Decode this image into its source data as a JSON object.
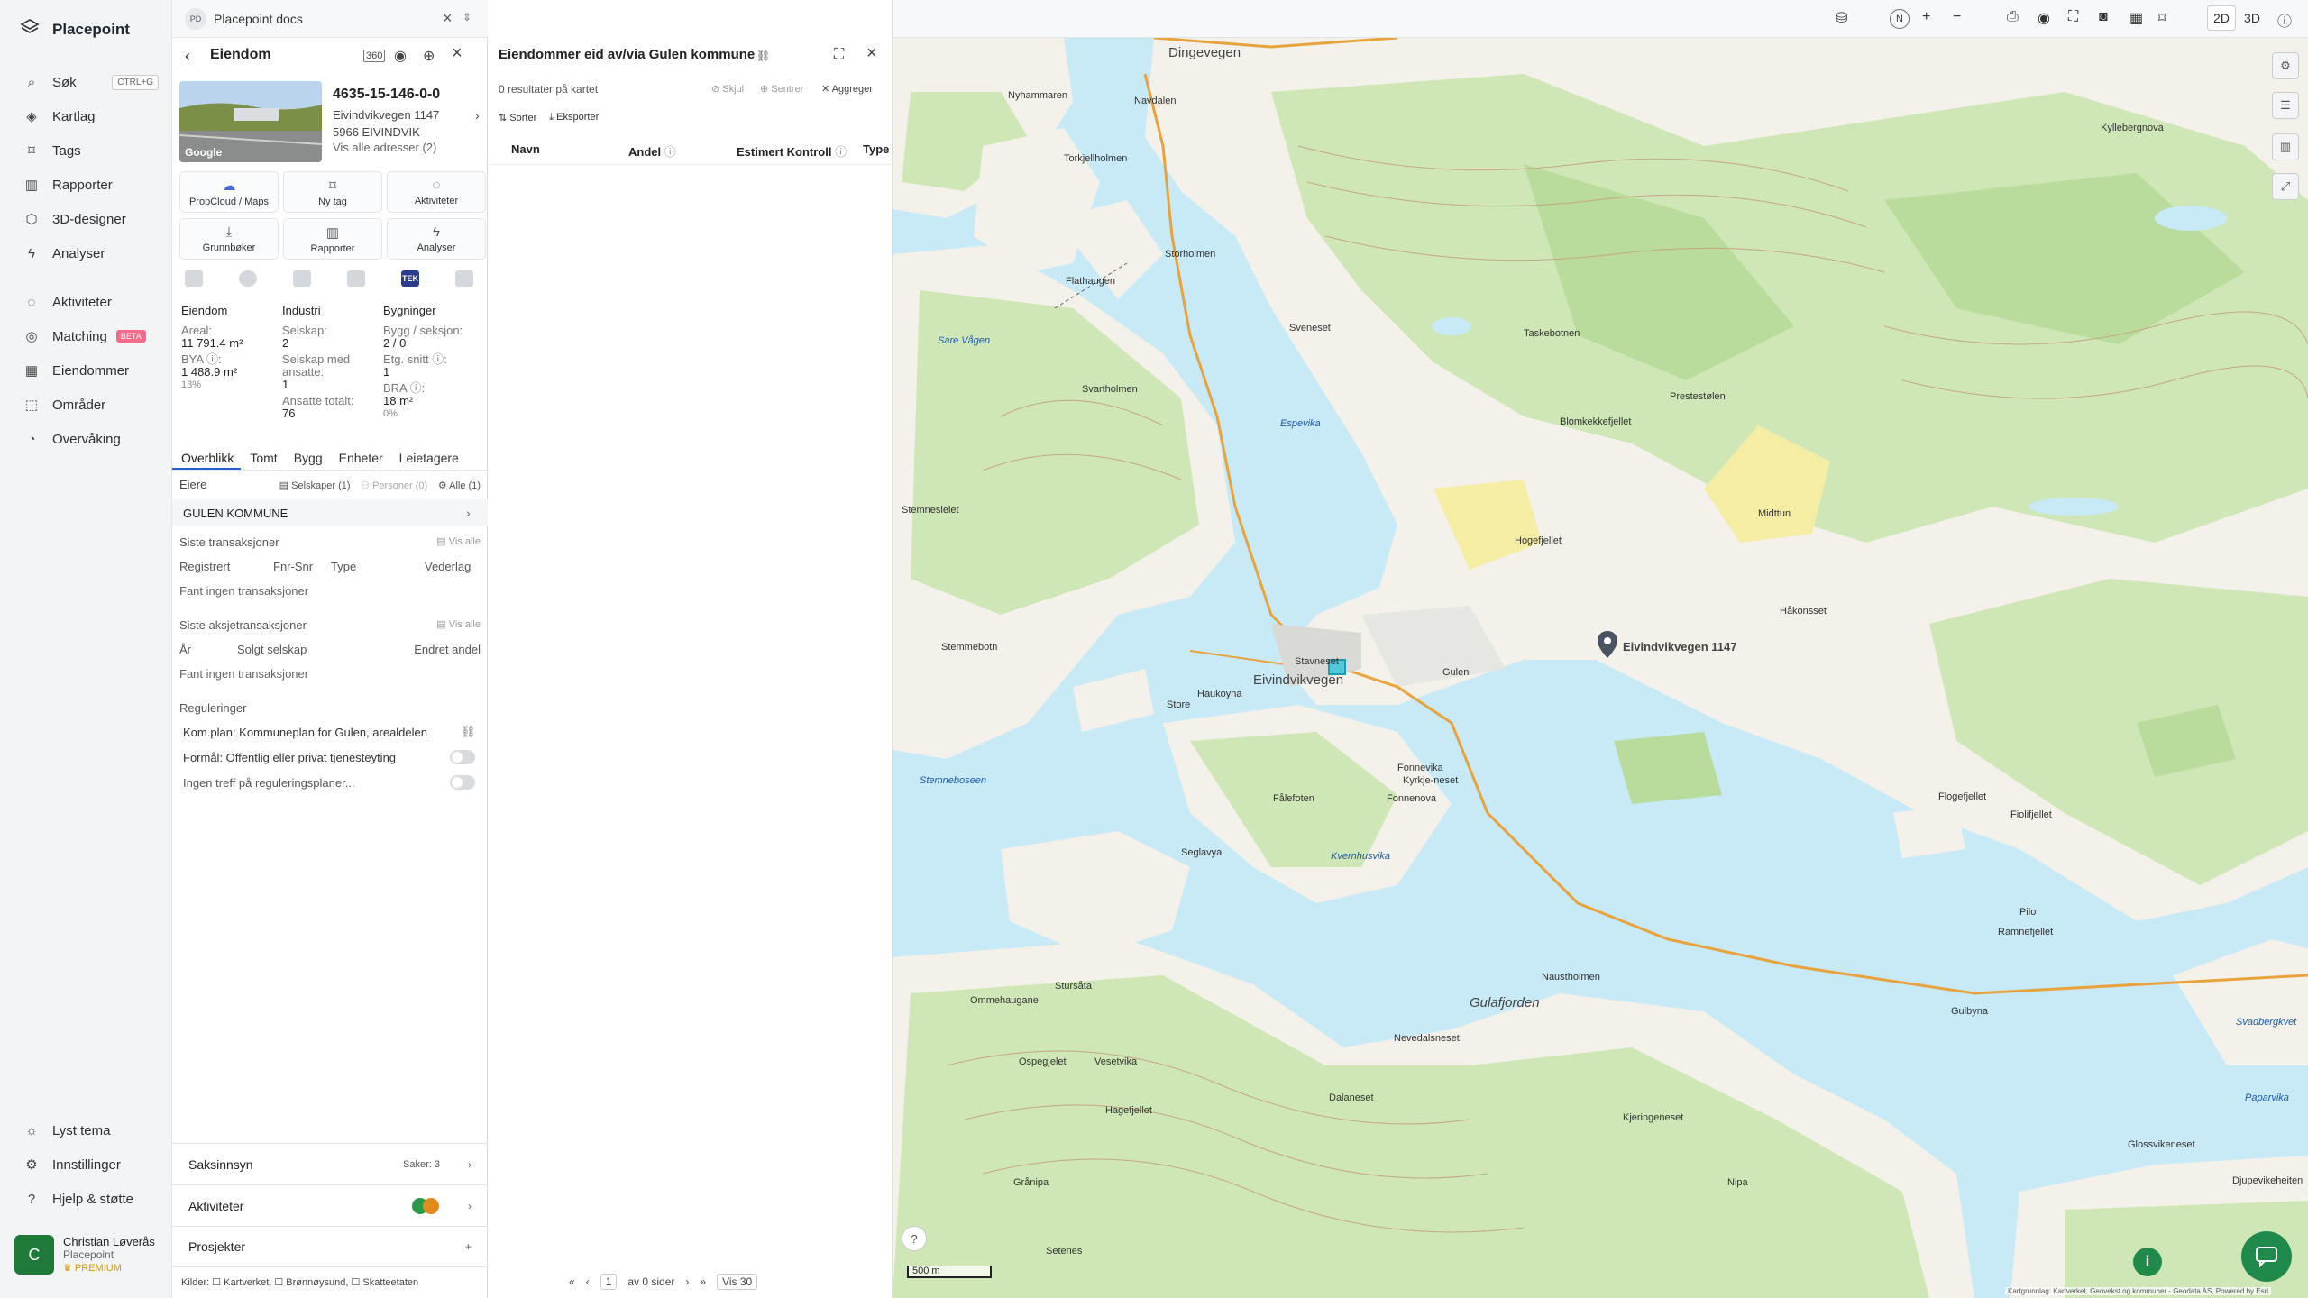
{
  "brand": {
    "name": "Placepoint"
  },
  "nav": {
    "items": [
      {
        "label": "Søk",
        "kbd": "CTRL+G"
      },
      {
        "label": "Kartlag"
      },
      {
        "label": "Tags"
      },
      {
        "label": "Rapporter"
      },
      {
        "label": "3D-designer"
      },
      {
        "label": "Analyser"
      },
      {
        "label": "Aktiviteter"
      },
      {
        "label": "Matching",
        "badge": "BETA"
      },
      {
        "label": "Eiendommer"
      },
      {
        "label": "Områder"
      },
      {
        "label": "Overvåking"
      }
    ],
    "bottom": [
      {
        "label": "Lyst tema"
      },
      {
        "label": "Innstillinger"
      },
      {
        "label": "Hjelp & støtte"
      }
    ]
  },
  "user": {
    "initial": "C",
    "name": "Christian Løverås",
    "org": "Placepoint",
    "tier": "PREMIUM"
  },
  "doc_tab": {
    "badge": "PD",
    "title": "Placepoint docs"
  },
  "panel1": {
    "title": "Eiendom",
    "property": {
      "id": "4635-15-146-0-0",
      "address_line1": "Eivindvikvegen 1147",
      "address_line2": "5966 EIVINDVIK",
      "all_addresses": "Vis alle adresser (2)",
      "thumb_label": "Google"
    },
    "actions": [
      {
        "label": "PropCloud / Maps"
      },
      {
        "label": "Ny tag"
      },
      {
        "label": "Aktiviteter"
      },
      {
        "label": "Grunnbøker"
      },
      {
        "label": "Rapporter"
      },
      {
        "label": "Analyser"
      }
    ],
    "tek_label": "TEK",
    "stats": {
      "col1": {
        "heading": "Eiendom",
        "areal_label": "Areal:",
        "areal_value": "11 791.4 m²",
        "bya_label": "BYA ⓘ:",
        "bya_value": "1 488.9 m²",
        "bya_pct": "13%"
      },
      "col2": {
        "heading": "Industri",
        "selskap_label": "Selskap:",
        "selskap_value": "2",
        "ansatte_label": "Selskap med ansatte:",
        "ansatte_value": "1",
        "totalt_label": "Ansatte totalt:",
        "totalt_value": "76"
      },
      "col3": {
        "heading": "Bygninger",
        "bygg_label": "Bygg / seksjon:",
        "bygg_value": "2 / 0",
        "etg_label": "Etg. snitt ⓘ:",
        "etg_value": "1",
        "bra_label": "BRA ⓘ:",
        "bra_value": "18 m²",
        "bra_pct": "0%"
      }
    },
    "subtabs": [
      "Overblikk",
      "Tomt",
      "Bygg",
      "Enheter",
      "Leietagere"
    ],
    "owners": {
      "label": "Eiere",
      "chip_companies": "Selskaper (1)",
      "chip_persons": "Personer (0)",
      "chip_all": "Alle (1)",
      "owner": "GULEN KOMMUNE"
    },
    "transactions": {
      "heading": "Siste transaksjoner",
      "show_all": "Vis alle",
      "cols": [
        "Registrert",
        "Fnr-Snr",
        "Type",
        "Vederlag"
      ],
      "empty": "Fant ingen transaksjoner"
    },
    "share_tx": {
      "heading": "Siste aksjetransaksjoner",
      "show_all": "Vis alle",
      "cols": [
        "År",
        "Solgt selskap",
        "Endret andel"
      ],
      "empty": "Fant ingen transaksjoner"
    },
    "regulations": {
      "heading": "Reguleringer",
      "plan": "Kom.plan: Kommuneplan for Gulen, arealdelen",
      "purpose": "Formål: Offentlig eller privat tjenesteyting",
      "none": "Ingen treff på reguleringsplaner..."
    },
    "accordions": [
      {
        "label": "Saksinnsyn",
        "right": "Saker: 3"
      },
      {
        "label": "Aktiviteter",
        "right": ""
      },
      {
        "label": "Prosjekter",
        "right": "+"
      }
    ],
    "sources": "Kilder: ☐ Kartverket, ☐ Brønnøysund, ☐ Skatteetaten"
  },
  "panel2": {
    "title": "Eiendommer eid av/via Gulen kommune",
    "results": "0 resultater på kartet",
    "hide": "Skjul",
    "center": "Sentrer",
    "aggregate": "Aggreger",
    "sort": "Sorter",
    "export": "Eksporter",
    "headers": [
      "Navn",
      "Andel",
      "Estimert Kontroll",
      "Type"
    ],
    "pager": {
      "page": "1",
      "of_pages": "av 0 sider",
      "per_page": "Vis 30"
    }
  },
  "map": {
    "mode_2d": "2D",
    "mode_3d": "3D",
    "compass": "N",
    "scale": "500 m",
    "attribution": "Kartgrunnlag: Kartverket, Geovekst og kommuner - Geodata AS, Powered by Esri",
    "pin_label": "Eivindvikvegen 1147",
    "labels": [
      {
        "t": "Dingevegen",
        "c": "big"
      },
      {
        "t": "Eivindvikvegen",
        "c": "big"
      },
      {
        "t": "Gulafjorden",
        "c": "w"
      },
      {
        "t": "Sare Vågen",
        "c": "w"
      },
      {
        "t": "Svartholmen",
        "c": ""
      },
      {
        "t": "Storholmen",
        "c": ""
      },
      {
        "t": "Flathaugen",
        "c": ""
      },
      {
        "t": "Sveneset",
        "c": ""
      },
      {
        "t": "Espevika",
        "c": "w"
      },
      {
        "t": "Taskebotnen",
        "c": ""
      },
      {
        "t": "Prestestølen",
        "c": ""
      },
      {
        "t": "Blomkekkefjellet",
        "c": ""
      },
      {
        "t": "Hogefjellet",
        "c": ""
      },
      {
        "t": "Midttun",
        "c": ""
      },
      {
        "t": "Gulen",
        "c": ""
      },
      {
        "t": "Fonnevika",
        "c": ""
      },
      {
        "t": "Fonnenova",
        "c": ""
      },
      {
        "t": "Fålefoten",
        "c": ""
      },
      {
        "t": "Seglavya",
        "c": ""
      },
      {
        "t": "Vesetvika",
        "c": ""
      },
      {
        "t": "Nevedalsneset",
        "c": ""
      },
      {
        "t": "Naustholmen",
        "c": ""
      },
      {
        "t": "Dalaneset",
        "c": ""
      },
      {
        "t": "Kjeringeneset",
        "c": ""
      },
      {
        "t": "Stemneboseen",
        "c": "w"
      },
      {
        "t": "Kvernhusvika",
        "c": "w"
      },
      {
        "t": "Stursåta",
        "c": ""
      },
      {
        "t": "Ommehaugane",
        "c": ""
      },
      {
        "t": "Ospegjelet",
        "c": ""
      },
      {
        "t": "Hagefjellet",
        "c": ""
      },
      {
        "t": "Ramnefjellet",
        "c": ""
      },
      {
        "t": "Flogefjellet",
        "c": ""
      },
      {
        "t": "Fiolifjellet",
        "c": ""
      },
      {
        "t": "Glossvikeneset",
        "c": ""
      },
      {
        "t": "Djupevikeheiten",
        "c": ""
      },
      {
        "t": "Paparvika",
        "c": "w"
      },
      {
        "t": "Kyrkje-neset",
        "c": ""
      },
      {
        "t": "Svadbergkvet",
        "c": "w"
      },
      {
        "t": "Håkonsset",
        "c": ""
      },
      {
        "t": "Navdalen",
        "c": ""
      },
      {
        "t": "Nyhammaren",
        "c": ""
      },
      {
        "t": "Torkjellholmen",
        "c": ""
      },
      {
        "t": "Kyllebergnova",
        "c": ""
      },
      {
        "t": "Stemmebotn",
        "c": ""
      },
      {
        "t": "Stemneslelet",
        "c": ""
      },
      {
        "t": "Store",
        "c": ""
      },
      {
        "t": "Stavneset",
        "c": ""
      },
      {
        "t": "Haukoyna",
        "c": ""
      },
      {
        "t": "Nipa",
        "c": ""
      },
      {
        "t": "Grånipa",
        "c": ""
      },
      {
        "t": "Setenes",
        "c": ""
      },
      {
        "t": "Gulbyna",
        "c": ""
      },
      {
        "t": "Pilo",
        "c": ""
      }
    ]
  }
}
